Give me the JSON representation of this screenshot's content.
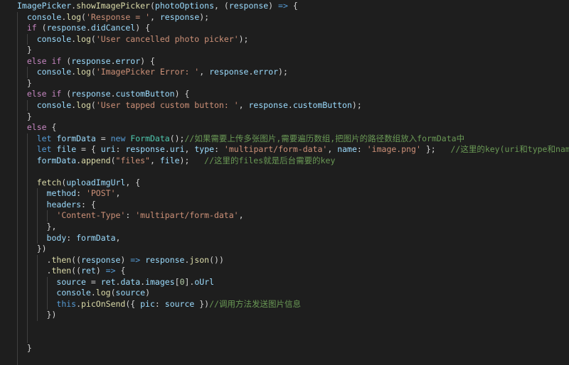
{
  "editor": {
    "theme": {
      "background": "#1e1e1e",
      "keyword": "#569cd6",
      "control": "#c586c0",
      "function": "#dcdcaa",
      "variable": "#9cdcfe",
      "class": "#4ec9b0",
      "string": "#ce9178",
      "number": "#b5cea8",
      "comment": "#6a9955",
      "text": "#d4d4d4"
    },
    "lines": [
      [
        [
          "var",
          "ImagePicker"
        ],
        [
          "pn",
          "."
        ],
        [
          "fn",
          "showImagePicker"
        ],
        [
          "pn",
          "("
        ],
        [
          "var",
          "photoOptions"
        ],
        [
          "pn",
          ", ("
        ],
        [
          "var",
          "response"
        ],
        [
          "pn",
          ") "
        ],
        [
          "kw",
          "=>"
        ],
        [
          "pn",
          " {"
        ]
      ],
      [
        [
          "pn",
          "  "
        ],
        [
          "var",
          "console"
        ],
        [
          "pn",
          "."
        ],
        [
          "fn",
          "log"
        ],
        [
          "pn",
          "("
        ],
        [
          "str",
          "'Response = '"
        ],
        [
          "pn",
          ", "
        ],
        [
          "var",
          "response"
        ],
        [
          "pn",
          ");"
        ]
      ],
      [
        [
          "pn",
          "  "
        ],
        [
          "ctl",
          "if"
        ],
        [
          "pn",
          " ("
        ],
        [
          "var",
          "response"
        ],
        [
          "pn",
          "."
        ],
        [
          "var",
          "didCancel"
        ],
        [
          "pn",
          ") {"
        ]
      ],
      [
        [
          "pn",
          "    "
        ],
        [
          "var",
          "console"
        ],
        [
          "pn",
          "."
        ],
        [
          "fn",
          "log"
        ],
        [
          "pn",
          "("
        ],
        [
          "str",
          "'User cancelled photo picker'"
        ],
        [
          "pn",
          ");"
        ]
      ],
      [
        [
          "pn",
          "  }"
        ]
      ],
      [
        [
          "pn",
          "  "
        ],
        [
          "ctl",
          "else if"
        ],
        [
          "pn",
          " ("
        ],
        [
          "var",
          "response"
        ],
        [
          "pn",
          "."
        ],
        [
          "var",
          "error"
        ],
        [
          "pn",
          ") {"
        ]
      ],
      [
        [
          "pn",
          "    "
        ],
        [
          "var",
          "console"
        ],
        [
          "pn",
          "."
        ],
        [
          "fn",
          "log"
        ],
        [
          "pn",
          "("
        ],
        [
          "str",
          "'ImagePicker Error: '"
        ],
        [
          "pn",
          ", "
        ],
        [
          "var",
          "response"
        ],
        [
          "pn",
          "."
        ],
        [
          "var",
          "error"
        ],
        [
          "pn",
          ");"
        ]
      ],
      [
        [
          "pn",
          "  }"
        ]
      ],
      [
        [
          "pn",
          "  "
        ],
        [
          "ctl",
          "else if"
        ],
        [
          "pn",
          " ("
        ],
        [
          "var",
          "response"
        ],
        [
          "pn",
          "."
        ],
        [
          "var",
          "customButton"
        ],
        [
          "pn",
          ") {"
        ]
      ],
      [
        [
          "pn",
          "    "
        ],
        [
          "var",
          "console"
        ],
        [
          "pn",
          "."
        ],
        [
          "fn",
          "log"
        ],
        [
          "pn",
          "("
        ],
        [
          "str",
          "'User tapped custom button: '"
        ],
        [
          "pn",
          ", "
        ],
        [
          "var",
          "response"
        ],
        [
          "pn",
          "."
        ],
        [
          "var",
          "customButton"
        ],
        [
          "pn",
          ");"
        ]
      ],
      [
        [
          "pn",
          "  }"
        ]
      ],
      [
        [
          "pn",
          "  "
        ],
        [
          "ctl",
          "else"
        ],
        [
          "pn",
          " {"
        ]
      ],
      [
        [
          "pn",
          "    "
        ],
        [
          "kw",
          "let"
        ],
        [
          "pn",
          " "
        ],
        [
          "var",
          "formData"
        ],
        [
          "pn",
          " = "
        ],
        [
          "kw",
          "new"
        ],
        [
          "pn",
          " "
        ],
        [
          "cls",
          "FormData"
        ],
        [
          "pn",
          "();"
        ],
        [
          "cmt",
          "//如果需要上传多张图片,需要遍历数组,把图片的路径数组放入formData中"
        ]
      ],
      [
        [
          "pn",
          "    "
        ],
        [
          "kw",
          "let"
        ],
        [
          "pn",
          " "
        ],
        [
          "var",
          "file"
        ],
        [
          "pn",
          " = { "
        ],
        [
          "var",
          "uri"
        ],
        [
          "pn",
          ": "
        ],
        [
          "var",
          "response"
        ],
        [
          "pn",
          "."
        ],
        [
          "var",
          "uri"
        ],
        [
          "pn",
          ", "
        ],
        [
          "var",
          "type"
        ],
        [
          "pn",
          ": "
        ],
        [
          "str",
          "'multipart/form-data'"
        ],
        [
          "pn",
          ", "
        ],
        [
          "var",
          "name"
        ],
        [
          "pn",
          ": "
        ],
        [
          "str",
          "'image.png'"
        ],
        [
          "pn",
          " };   "
        ],
        [
          "cmt",
          "//这里的key(uri和type和name)不能改变,"
        ]
      ],
      [
        [
          "pn",
          "    "
        ],
        [
          "var",
          "formData"
        ],
        [
          "pn",
          "."
        ],
        [
          "fn",
          "append"
        ],
        [
          "pn",
          "("
        ],
        [
          "str",
          "\"files\""
        ],
        [
          "pn",
          ", "
        ],
        [
          "var",
          "file"
        ],
        [
          "pn",
          ");   "
        ],
        [
          "cmt",
          "//这里的files就是后台需要的key"
        ]
      ],
      [],
      [
        [
          "pn",
          "    "
        ],
        [
          "fn",
          "fetch"
        ],
        [
          "pn",
          "("
        ],
        [
          "var",
          "uploadImgUrl"
        ],
        [
          "pn",
          ", {"
        ]
      ],
      [
        [
          "pn",
          "      "
        ],
        [
          "var",
          "method"
        ],
        [
          "pn",
          ": "
        ],
        [
          "str",
          "'POST'"
        ],
        [
          "pn",
          ","
        ]
      ],
      [
        [
          "pn",
          "      "
        ],
        [
          "var",
          "headers"
        ],
        [
          "pn",
          ": {"
        ]
      ],
      [
        [
          "pn",
          "        "
        ],
        [
          "str",
          "'Content-Type'"
        ],
        [
          "pn",
          ": "
        ],
        [
          "str",
          "'multipart/form-data'"
        ],
        [
          "pn",
          ","
        ]
      ],
      [
        [
          "pn",
          "      },"
        ]
      ],
      [
        [
          "pn",
          "      "
        ],
        [
          "var",
          "body"
        ],
        [
          "pn",
          ": "
        ],
        [
          "var",
          "formData"
        ],
        [
          "pn",
          ","
        ]
      ],
      [
        [
          "pn",
          "    })"
        ]
      ],
      [
        [
          "pn",
          "      ."
        ],
        [
          "fn",
          "then"
        ],
        [
          "pn",
          "(("
        ],
        [
          "var",
          "response"
        ],
        [
          "pn",
          ") "
        ],
        [
          "kw",
          "=>"
        ],
        [
          "pn",
          " "
        ],
        [
          "var",
          "response"
        ],
        [
          "pn",
          "."
        ],
        [
          "fn",
          "json"
        ],
        [
          "pn",
          "())"
        ]
      ],
      [
        [
          "pn",
          "      ."
        ],
        [
          "fn",
          "then"
        ],
        [
          "pn",
          "(("
        ],
        [
          "var",
          "ret"
        ],
        [
          "pn",
          ") "
        ],
        [
          "kw",
          "=>"
        ],
        [
          "pn",
          " {"
        ]
      ],
      [
        [
          "pn",
          "        "
        ],
        [
          "var",
          "source"
        ],
        [
          "pn",
          " = "
        ],
        [
          "var",
          "ret"
        ],
        [
          "pn",
          "."
        ],
        [
          "var",
          "data"
        ],
        [
          "pn",
          "."
        ],
        [
          "var",
          "images"
        ],
        [
          "pn",
          "["
        ],
        [
          "num",
          "0"
        ],
        [
          "pn",
          "]."
        ],
        [
          "var",
          "oUrl"
        ]
      ],
      [
        [
          "pn",
          "        "
        ],
        [
          "var",
          "console"
        ],
        [
          "pn",
          "."
        ],
        [
          "fn",
          "log"
        ],
        [
          "pn",
          "("
        ],
        [
          "var",
          "source"
        ],
        [
          "pn",
          ")"
        ]
      ],
      [
        [
          "pn",
          "        "
        ],
        [
          "kw",
          "this"
        ],
        [
          "pn",
          "."
        ],
        [
          "fn",
          "picOnSend"
        ],
        [
          "pn",
          "({ "
        ],
        [
          "var",
          "pic"
        ],
        [
          "pn",
          ": "
        ],
        [
          "var",
          "source"
        ],
        [
          "pn",
          " })"
        ],
        [
          "cmt",
          "//调用方法发送图片信息"
        ]
      ],
      [
        [
          "pn",
          "      })"
        ]
      ],
      [],
      [],
      [
        [
          "pn",
          "  }"
        ]
      ],
      [],
      [
        [
          "pn",
          "})"
        ]
      ]
    ]
  }
}
